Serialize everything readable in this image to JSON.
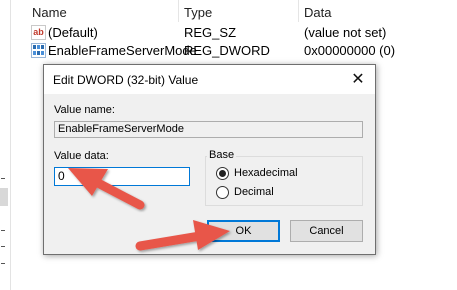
{
  "registry": {
    "columns": {
      "name": "Name",
      "type": "Type",
      "data": "Data"
    },
    "rows": [
      {
        "icon": "string-value-icon",
        "icon_text": "ab",
        "name": "(Default)",
        "type": "REG_SZ",
        "data": "(value not set)"
      },
      {
        "icon": "binary-value-icon",
        "name": "EnableFrameServerMode",
        "type": "REG_DWORD",
        "data": "0x00000000 (0)"
      }
    ]
  },
  "dialog": {
    "title": "Edit DWORD (32-bit) Value",
    "close_glyph": "✕",
    "value_name_label": "Value name:",
    "value_name": "EnableFrameServerMode",
    "value_data_label": "Value data:",
    "value_data": "0",
    "base_label": "Base",
    "base_options": [
      {
        "label": "Hexadecimal",
        "checked": true
      },
      {
        "label": "Decimal",
        "checked": false
      }
    ],
    "ok_label": "OK",
    "cancel_label": "Cancel"
  },
  "colors": {
    "arrow": "#e8574a",
    "focus_border": "#0078d7",
    "dialog_body": "#f0f0f0"
  }
}
